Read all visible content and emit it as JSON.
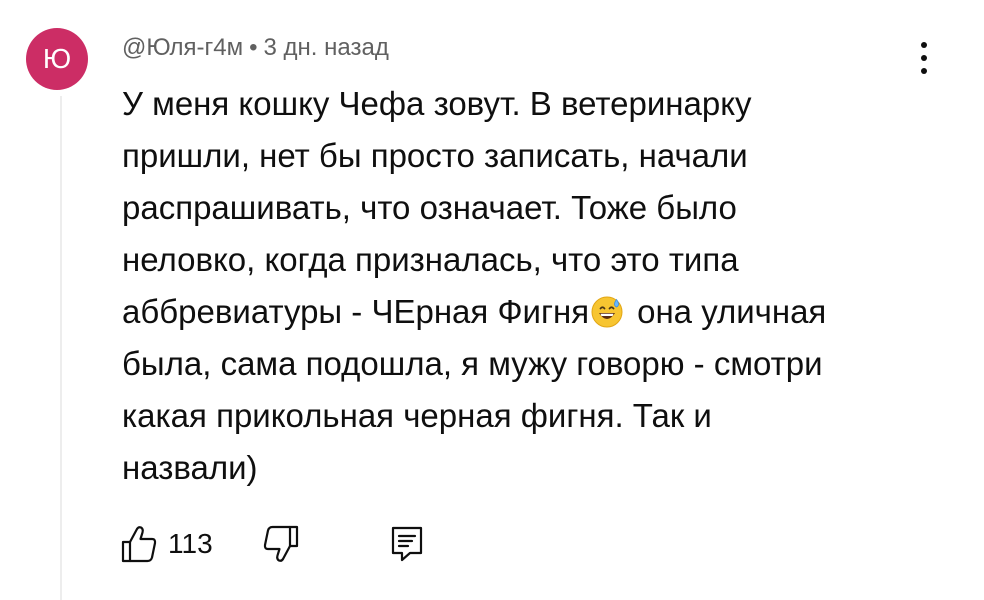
{
  "comment": {
    "avatar_letter": "Ю",
    "avatar_color": "#cc2d65",
    "author": "@Юля-г4м",
    "separator": "•",
    "time": "3 дн. назад",
    "lines": [
      "У меня кошку Чефа зовут. В ветеринарку",
      "пришли, нет бы просто записать, начали",
      "распрашивать, что означает. Тоже было",
      "неловко, когда призналась, что это типа"
    ],
    "line5_before_emoji": "аббревиатуры - ЧЕрная Фигня",
    "emoji": "grinning-face-with-sweat-emoji",
    "line5_after_emoji": "она уличная",
    "lines_after": [
      "была, сама подошла, я мужу говорю - смотри",
      "какая прикольная черная фигня. Так и",
      "назвали)"
    ]
  },
  "actions": {
    "like_icon": "thumbs-up-icon",
    "like_count": "113",
    "dislike_icon": "thumbs-down-icon",
    "reply_icon": "reply-comment-icon"
  },
  "menu_icon": "more-vertical-icon"
}
